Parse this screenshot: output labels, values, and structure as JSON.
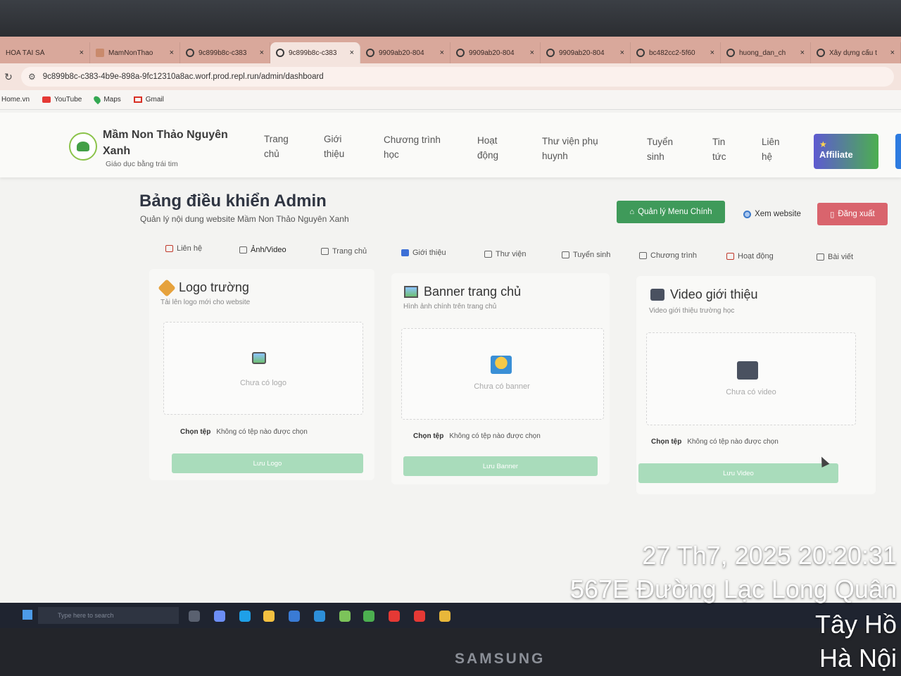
{
  "browser": {
    "tabs": [
      {
        "title": "HÓA TÀI SẢ",
        "active": false
      },
      {
        "title": "MamNonThao",
        "active": false
      },
      {
        "title": "9c899b8c-c383",
        "active": false
      },
      {
        "title": "9c899b8c-c383",
        "active": true
      },
      {
        "title": "9909ab20-804",
        "active": false
      },
      {
        "title": "9909ab20-804",
        "active": false
      },
      {
        "title": "9909ab20-804",
        "active": false
      },
      {
        "title": "bc482cc2-5f60",
        "active": false
      },
      {
        "title": "huong_dan_ch",
        "active": false
      },
      {
        "title": "Xây dựng cấu t",
        "active": false
      }
    ],
    "close_glyph": "×",
    "url": "9c899b8c-c383-4b9e-898a-9fc12310a8ac.worf.prod.repl.run/admin/dashboard",
    "bookmarks": [
      "Home.vn",
      "YouTube",
      "Maps",
      "Gmail"
    ]
  },
  "site": {
    "brand_name": "Mầm Non Thảo Nguyên Xanh",
    "tagline": "Giáo dục bằng trái tim",
    "nav": [
      {
        "line1": "Trang",
        "line2": "chủ"
      },
      {
        "line1": "Giới",
        "line2": "thiệu"
      },
      {
        "line1": "Chương trình",
        "line2": "học"
      },
      {
        "line1": "Hoạt",
        "line2": "động"
      },
      {
        "line1": "Thư viện phụ",
        "line2": "huynh"
      },
      {
        "line1": "Tuyển",
        "line2": "sinh"
      },
      {
        "line1": "Tin",
        "line2": "tức"
      },
      {
        "line1": "Liên",
        "line2": "hệ"
      }
    ],
    "affiliate_label": "Affiliate"
  },
  "admin": {
    "title": "Bảng điều khiển Admin",
    "subtitle": "Quản lý nội dung website Mầm Non Thảo Nguyên Xanh",
    "menu_button": "Quản lý Menu Chính",
    "view_button": "Xem website",
    "logout_button": "Đăng xuất",
    "tabs": [
      "Liên hệ",
      "Ảnh/Video",
      "Trang chủ",
      "Giới thiệu",
      "Thư viện",
      "Tuyển sinh",
      "Chương trình",
      "Hoạt động",
      "Bài viết"
    ],
    "active_tab": "Ảnh/Video",
    "cards": [
      {
        "title": "Logo trường",
        "subtitle": "Tải lên logo mới cho website",
        "empty": "Chưa có logo",
        "choose": "Chọn tệp",
        "no_file": "Không có tệp nào được chọn",
        "save": "Lưu Logo"
      },
      {
        "title": "Banner trang chủ",
        "subtitle": "Hình ảnh chính trên trang chủ",
        "empty": "Chưa có banner",
        "choose": "Chọn tệp",
        "no_file": "Không có tệp nào được chọn",
        "save": "Lưu Banner"
      },
      {
        "title": "Video giới thiệu",
        "subtitle": "Video giới thiệu trường học",
        "empty": "Chưa có video",
        "choose": "Chọn tệp",
        "no_file": "Không có tệp nào được chọn",
        "save": "Lưu Video"
      }
    ]
  },
  "taskbar": {
    "search_placeholder": "Type here to search"
  },
  "monitor_brand": "SAMSUNG",
  "overlay": {
    "datetime": "27 Th7, 2025 20:20:31",
    "street": "567E Đường Lạc Long Quân",
    "district": "Tây Hồ",
    "city": "Hà Nội"
  },
  "colors": {
    "tabstrip": "#d9a89b",
    "menu_button": "#3f9a5a",
    "logout_button": "#d9646d",
    "save_button": "#a9dcbb"
  }
}
